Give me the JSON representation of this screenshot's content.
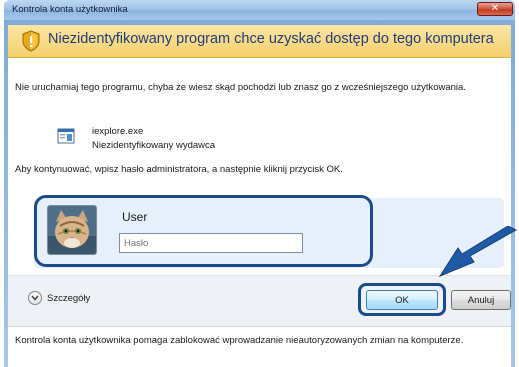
{
  "window": {
    "title": "Kontrola konta użytkownika",
    "close_label": "✕"
  },
  "banner": {
    "text": "Niezidentyfikowany program chce uzyskać dostęp do tego komputera"
  },
  "content": {
    "warning": "Nie uruchamiaj tego programu, chyba że wiesz skąd pochodzi lub znasz go z wcześniejszego użytkowania.",
    "program_name": "iexplore.exe",
    "program_publisher": "Niezidentyfikowany wydawca",
    "instruction": "Aby kontynuować, wpisz hasło administratora, a następnie kliknij przycisk OK."
  },
  "credentials": {
    "user_name": "User",
    "password_placeholder": "Hasło"
  },
  "buttons": {
    "details": "Szczegóły",
    "ok": "OK",
    "cancel": "Anuluj"
  },
  "footer": {
    "text": "Kontrola konta użytkownika pomaga zablokować wprowadzanie nieautoryzowanych zmian na komputerze."
  },
  "colors": {
    "banner": "#f5cf6a",
    "highlight": "#1a4c8c",
    "arrow": "#1f5aa6"
  },
  "icons": [
    "shield-warning-icon",
    "program-icon",
    "user-avatar",
    "chevron-down-icon",
    "pointer-arrow"
  ]
}
